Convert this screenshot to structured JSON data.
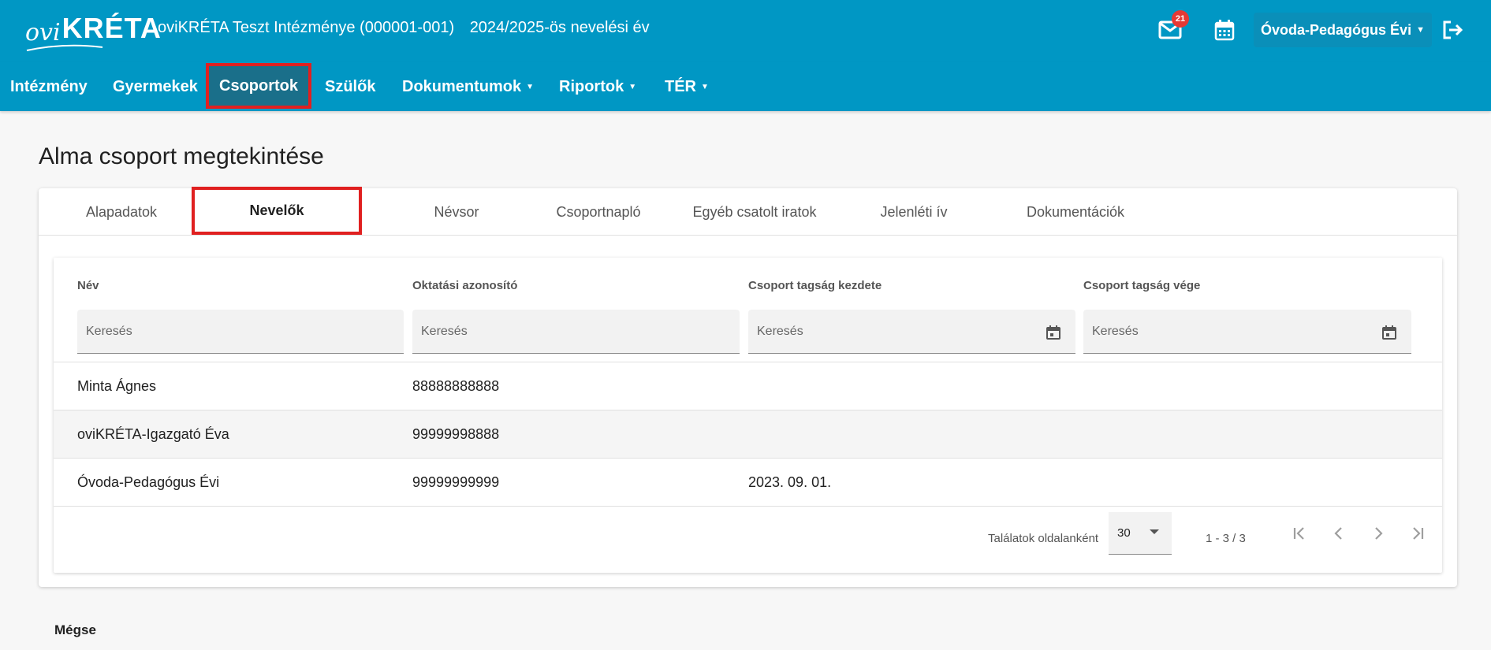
{
  "app": {
    "logo_text_ovi": "ovi",
    "logo_text_kreta": "KRÉTA",
    "institution": "oviKRÉTA Teszt Intézménye (000001-001)",
    "school_year": "2024/2025-ös nevelési év",
    "mail_badge": "21",
    "user_name": "Óvoda-Pedagógus Évi",
    "colors": {
      "primary": "#0097c4",
      "active_nav": "#1a6f8a",
      "highlight": "#e02020",
      "badge": "#e53935"
    }
  },
  "nav": {
    "items": [
      {
        "label": "Intézmény"
      },
      {
        "label": "Gyermekek"
      },
      {
        "label": "Csoportok"
      },
      {
        "label": "Szülők"
      },
      {
        "label": "Dokumentumok"
      },
      {
        "label": "Riportok"
      },
      {
        "label": "TÉR"
      }
    ],
    "active": "Csoportok"
  },
  "page": {
    "title": "Alma csoport megtekintése",
    "cancel_label": "Mégse"
  },
  "tabs": {
    "items": [
      {
        "label": "Alapadatok"
      },
      {
        "label": "Nevelők"
      },
      {
        "label": "Névsor"
      },
      {
        "label": "Csoportnapló"
      },
      {
        "label": "Egyéb csatolt iratok"
      },
      {
        "label": "Jelenléti ív"
      },
      {
        "label": "Dokumentációk"
      }
    ],
    "active": "Nevelők"
  },
  "table": {
    "columns": [
      {
        "label": "Név",
        "placeholder": "Keresés"
      },
      {
        "label": "Oktatási azonosító",
        "placeholder": "Keresés"
      },
      {
        "label": "Csoport tagság kezdete",
        "placeholder": "Keresés"
      },
      {
        "label": "Csoport tagság vége",
        "placeholder": "Keresés"
      }
    ],
    "rows": [
      {
        "name": "Minta Ágnes",
        "id": "88888888888",
        "start": "",
        "end": ""
      },
      {
        "name": "oviKRÉTA-Igazgató Éva",
        "id": "99999998888",
        "start": "",
        "end": ""
      },
      {
        "name": "Óvoda-Pedagógus Évi",
        "id": "99999999999",
        "start": "2023. 09. 01.",
        "end": ""
      }
    ],
    "pager": {
      "per_page_label": "Találatok oldalanként",
      "per_page_value": "30",
      "range": "1 - 3 / 3"
    }
  }
}
